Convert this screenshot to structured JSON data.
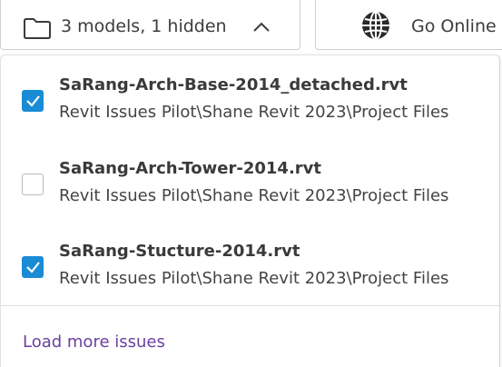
{
  "toolbar": {
    "models_label": "3 models, 1 hidden",
    "online_label": "Go Online"
  },
  "models": [
    {
      "name": "SaRang-Arch-Base-2014_detached.rvt",
      "path": "Revit Issues Pilot\\Shane Revit 2023\\Project Files",
      "checked": true
    },
    {
      "name": "SaRang-Arch-Tower-2014.rvt",
      "path": "Revit Issues Pilot\\Shane Revit 2023\\Project Files",
      "checked": false
    },
    {
      "name": "SaRang-Stucture-2014.rvt",
      "path": "Revit Issues Pilot\\Shane Revit 2023\\Project Files",
      "checked": true
    }
  ],
  "load_more_label": "Load more issues",
  "colors": {
    "checkbox_checked": "#1a8bd5",
    "link": "#6a3fa0",
    "border": "#cfcfcf"
  }
}
